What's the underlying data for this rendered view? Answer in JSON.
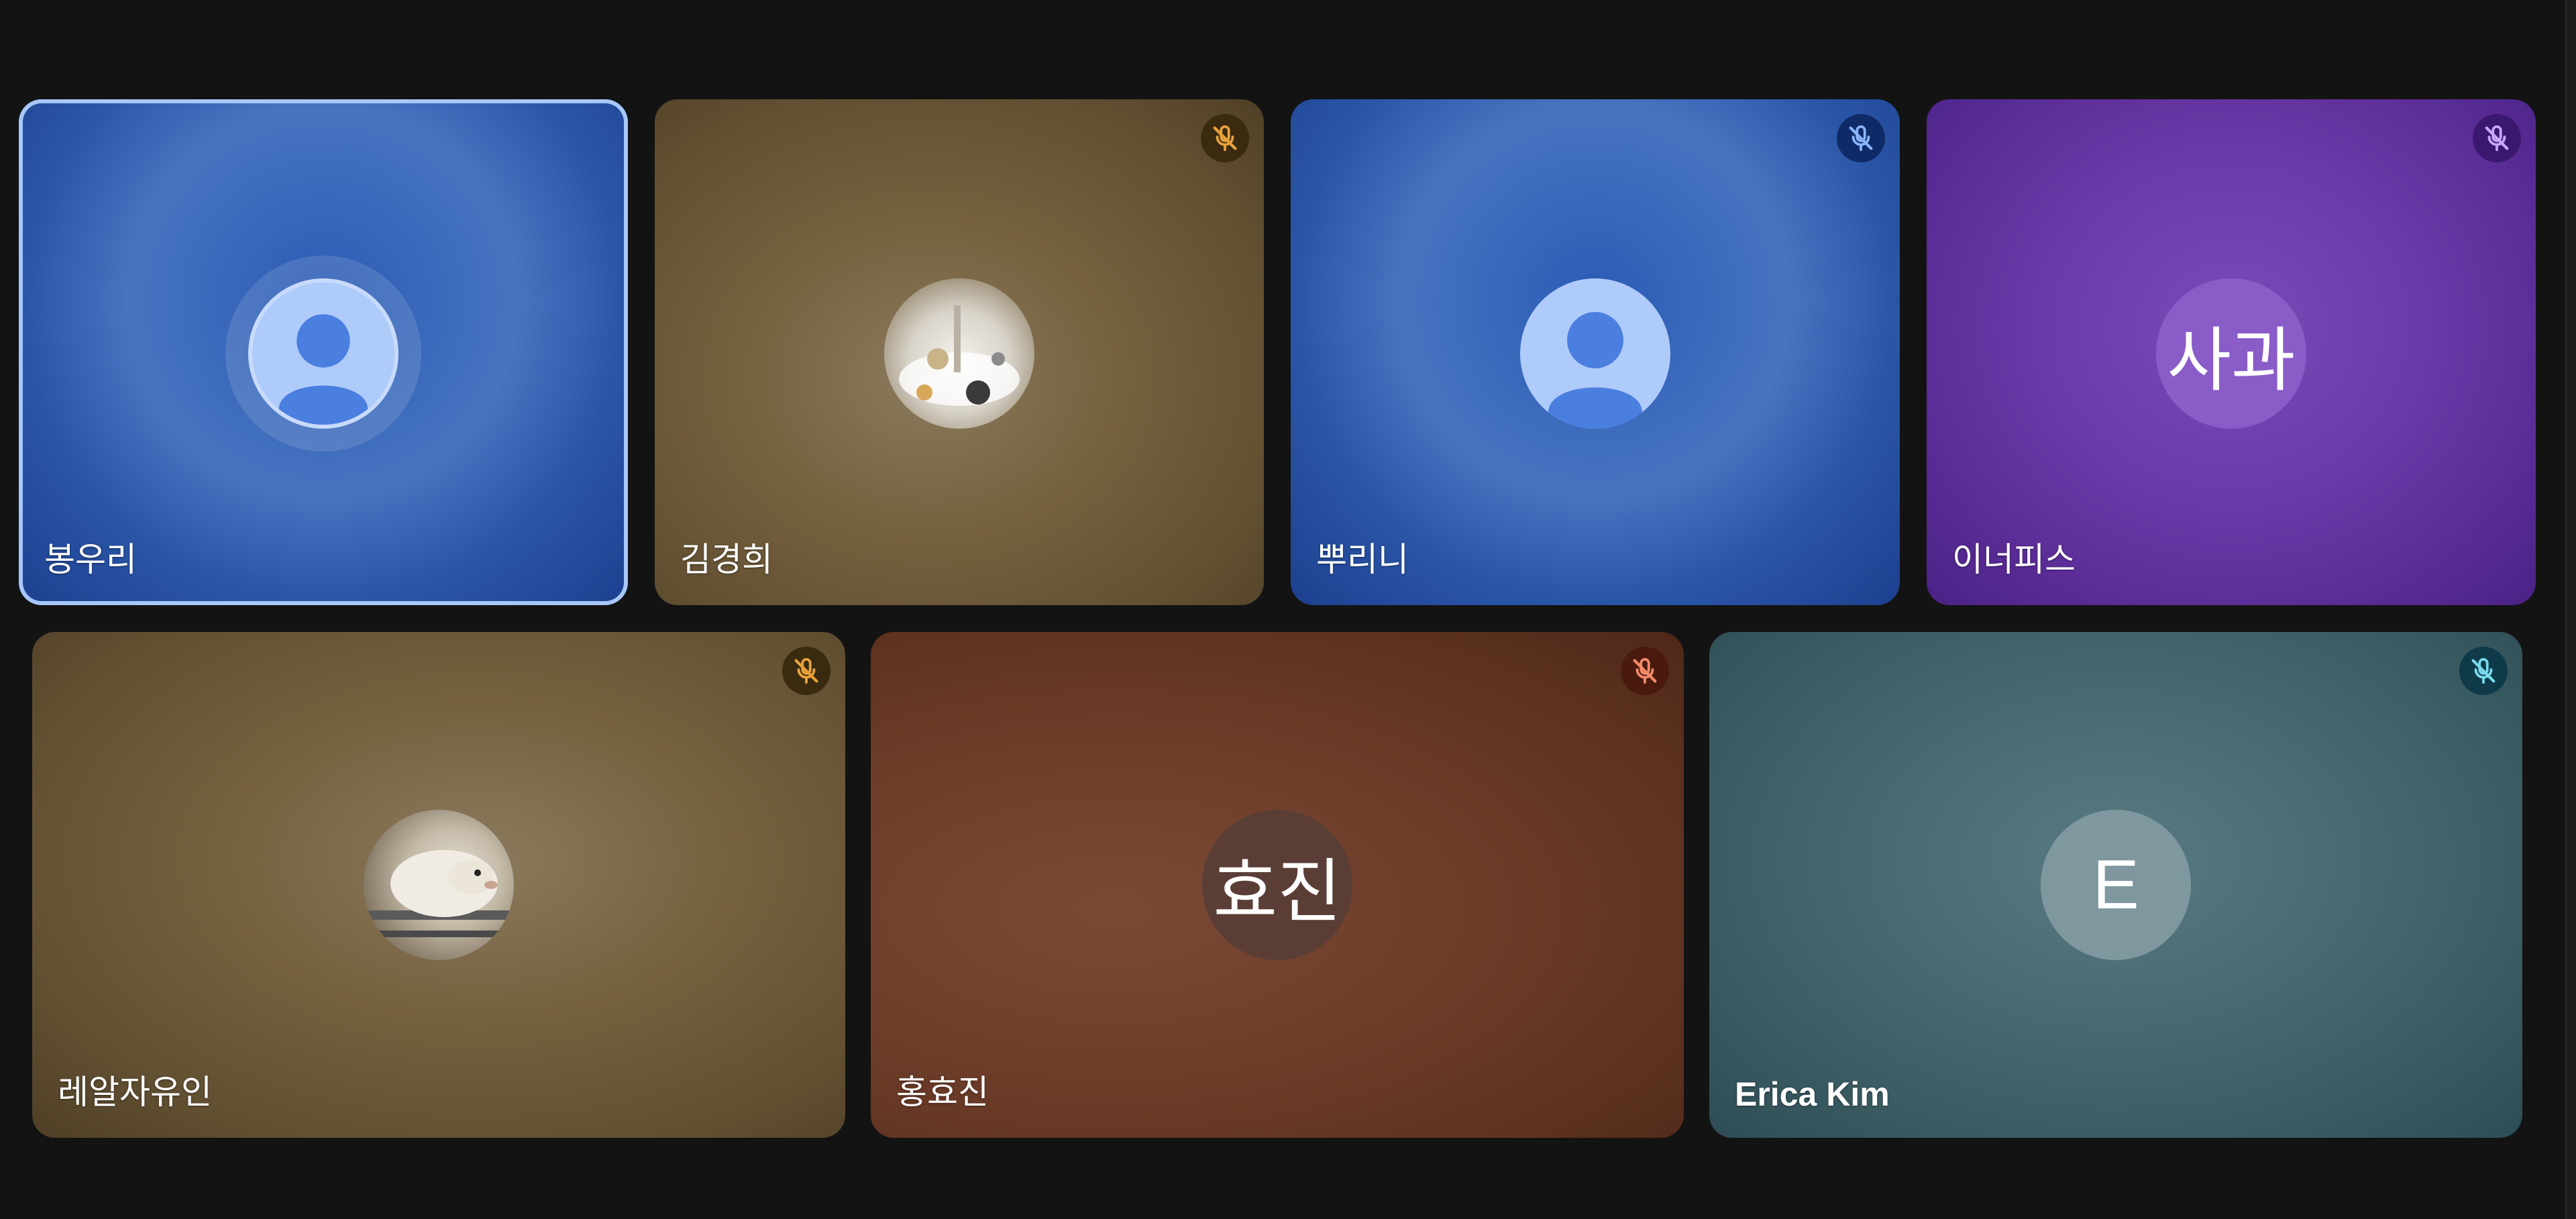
{
  "colors": {
    "background": "#131313",
    "active_border": "#a8c7fa"
  },
  "participants": [
    {
      "name": "봉우리",
      "active": true,
      "muted": false,
      "avatar_type": "default-person",
      "avatar_text": "",
      "tile_color": "#2f58a8",
      "mic_color": ""
    },
    {
      "name": "김경희",
      "active": false,
      "muted": true,
      "avatar_type": "photo",
      "photo_subject": "table-setting",
      "avatar_text": "",
      "tile_color": "#6e5a3a",
      "mic_color": "#e8a23c"
    },
    {
      "name": "뿌리니",
      "active": false,
      "muted": true,
      "avatar_type": "default-person",
      "avatar_text": "",
      "tile_color": "#2f58a8",
      "mic_color": "#8ab4f8"
    },
    {
      "name": "이너피스",
      "active": false,
      "muted": true,
      "avatar_type": "initials",
      "avatar_text": "사과",
      "tile_color": "#5e2f9c",
      "mic_color": "#c9a6ff"
    },
    {
      "name": "레알자유인",
      "active": false,
      "muted": true,
      "avatar_type": "photo",
      "photo_subject": "sheep",
      "avatar_text": "",
      "tile_color": "#6e5a3a",
      "mic_color": "#e8a23c"
    },
    {
      "name": "홍효진",
      "active": false,
      "muted": true,
      "avatar_type": "initials",
      "avatar_text": "효진",
      "tile_color": "#6b3622",
      "mic_color": "#f28b6a"
    },
    {
      "name": "Erica Kim",
      "active": false,
      "muted": true,
      "avatar_type": "initials",
      "avatar_text": "E",
      "tile_color": "#3a5e68",
      "mic_color": "#78d9ec"
    }
  ]
}
